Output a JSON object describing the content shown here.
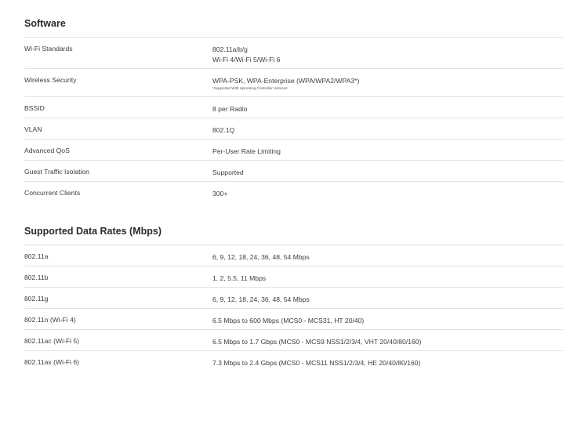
{
  "software": {
    "title": "Software",
    "rows": [
      {
        "label": "Wi-Fi Standards",
        "value_line1": "802.11a/b/g",
        "value_line2": "Wi-Fi 4/Wi-Fi 5/Wi-Fi 6"
      },
      {
        "label": "Wireless Security",
        "value": "WPA-PSK, WPA-Enterprise (WPA/WPA2/WPA3*)",
        "note": "*Supported With Upcoming Controller Versions"
      },
      {
        "label": "BSSID",
        "value": "8 per Radio"
      },
      {
        "label": "VLAN",
        "value": "802.1Q"
      },
      {
        "label": "Advanced QoS",
        "value": "Per-User Rate Limiting"
      },
      {
        "label": "Guest Traffic Isolation",
        "value": "Supported"
      },
      {
        "label": "Concurrent Clients",
        "value": "300+"
      }
    ]
  },
  "data_rates": {
    "title": "Supported Data Rates (Mbps)",
    "rows": [
      {
        "label": "802.11a",
        "value": "6, 9, 12, 18, 24, 36, 48, 54 Mbps"
      },
      {
        "label": "802.11b",
        "value": "1, 2, 5.5, 11 Mbps"
      },
      {
        "label": "802.11g",
        "value": "6, 9, 12, 18, 24, 36, 48, 54 Mbps"
      },
      {
        "label": "802.11n (Wi-Fi 4)",
        "value": "6.5 Mbps to 600 Mbps (MCS0 - MCS31, HT 20/40)"
      },
      {
        "label": "802.11ac (Wi-Fi 5)",
        "value": "6.5 Mbps to 1.7 Gbps (MCS0 - MCS9 NSS1/2/3/4, VHT 20/40/80/160)"
      },
      {
        "label": "802.11ax (Wi-Fi 6)",
        "value": "7.3 Mbps to 2.4 Gbps (MCS0 - MCS11 NSS1/2/3/4, HE 20/40/80/160)"
      }
    ]
  }
}
